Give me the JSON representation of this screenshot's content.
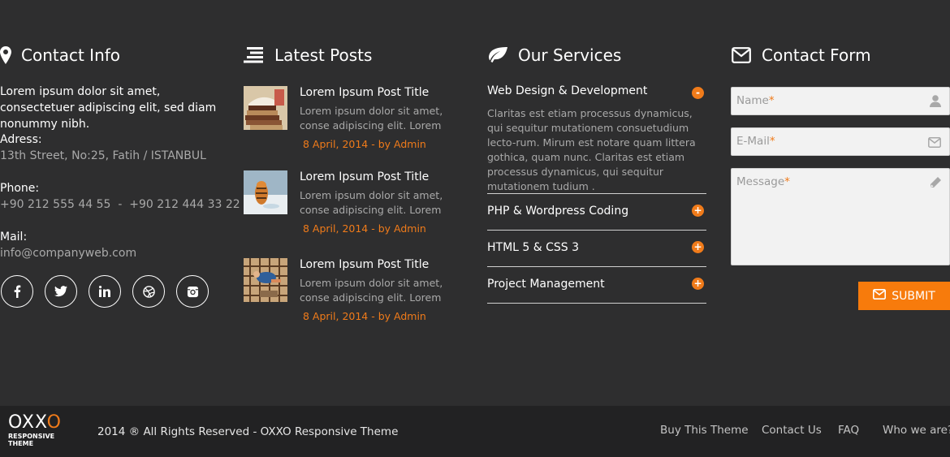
{
  "contact_info": {
    "title": "Contact Info",
    "icon": "map-marker-icon",
    "intro": "Lorem ipsum dolor sit amet, consectetuer adipiscing elit, sed diam nonummy nibh.",
    "address_label": "Adress:",
    "address_value": "13th Street, No:25, Fatih / ISTANBUL",
    "phone_label": "Phone:",
    "phone_value": "+90 212 555 44 55  -  +90 212 444 33 22",
    "mail_label": "Mail:",
    "mail_value": "info@companyweb.com",
    "socials": [
      "facebook-icon",
      "twitter-icon",
      "linkedin-icon",
      "dribbble-icon",
      "instagram-icon"
    ]
  },
  "latest_posts": {
    "title": "Latest Posts",
    "icon": "list-icon",
    "posts": [
      {
        "title": "Lorem Ipsum Post Title",
        "excerpt": "Lorem ipsum dolor sit amet, conse adipiscing elit. Lorem",
        "meta": "8 April, 2014 - by Admin"
      },
      {
        "title": "Lorem Ipsum Post Title",
        "excerpt": "Lorem ipsum dolor sit amet, conse adipiscing elit. Lorem",
        "meta": "8 April, 2014 - by Admin"
      },
      {
        "title": "Lorem Ipsum Post Title",
        "excerpt": "Lorem ipsum dolor sit amet, conse adipiscing elit. Lorem",
        "meta": "8 April, 2014 - by Admin"
      }
    ]
  },
  "services": {
    "title": "Our Services",
    "icon": "leaf-icon",
    "open_item": {
      "title": "Web Design & Development",
      "toggle": "-",
      "description": "Claritas est etiam processus dynamicus, qui sequitur mutationem consuetudium lecto-rum. Mirum est notare quam littera gothica, quam nunc. Claritas est etiam processus dynamicus, qui sequitur mutationem tudium ."
    },
    "items": [
      {
        "title": "PHP & Wordpress Coding",
        "toggle": "+"
      },
      {
        "title": "HTML 5 & CSS 3",
        "toggle": "+"
      },
      {
        "title": "Project Management",
        "toggle": "+"
      }
    ]
  },
  "contact_form": {
    "title": "Contact Form",
    "icon": "envelope-icon",
    "name_placeholder": "Name",
    "email_placeholder": "E-Mail",
    "message_placeholder": "Message",
    "required_mark": "*",
    "submit_label": "SUBMIT"
  },
  "footer": {
    "logo_text_1": "OXX",
    "logo_text_2": "O",
    "logo_sub": "RESPONSIVE THEME",
    "copyright": "2014 ® All Rights Reserved - OXXO Responsive Theme",
    "nav": [
      "Buy This Theme",
      "Contact Us",
      "FAQ",
      "Who we are?"
    ]
  },
  "colors": {
    "accent": "#f77b0c",
    "background": "#2e2e2f",
    "footer_bg": "#222223"
  }
}
